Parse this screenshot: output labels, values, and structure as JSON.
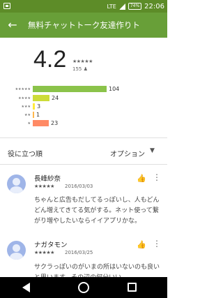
{
  "status_bar": {
    "battery": "74%",
    "network": "LTE",
    "time": "22:06"
  },
  "app_bar": {
    "back_icon": "arrow-left-icon",
    "title": "無料チャットトーク友達作りト"
  },
  "summary": {
    "rating": "4.2",
    "stars": "★★★★★",
    "total_reviews": "155"
  },
  "histogram": [
    {
      "stars_label": "★★★★★",
      "count": 104,
      "color": "#8bc34a"
    },
    {
      "stars_label": "★★★★",
      "count": 24,
      "color": "#cddc39"
    },
    {
      "stars_label": "★★★",
      "count": 3,
      "color": "#ffeb3b"
    },
    {
      "stars_label": "★★",
      "count": 1,
      "color": "#ffb74d"
    },
    {
      "stars_label": "★",
      "count": 23,
      "color": "#ff8a65"
    }
  ],
  "sort": {
    "label": "役に立つ順",
    "option_label": "オプション",
    "option_arrow": "▼"
  },
  "reviews": [
    {
      "name": "長峰紗奈",
      "stars": "★★★★★",
      "date": "2016/03/03",
      "text": "ちゃんと広告もだしてるっぽいし、人もどんどん増えてきてる気がする。ネット使って繋がり増やしたいならイイアプリかな。"
    },
    {
      "name": "ナガタモン",
      "stars": "★★★★★",
      "date": "2016/03/25",
      "text": "サクラっぽいのがいまの所はいないのも良いと思います。その辺の何分いい"
    }
  ],
  "colors": {
    "status_bar": "#5d8c28",
    "app_bar": "#689f38"
  }
}
